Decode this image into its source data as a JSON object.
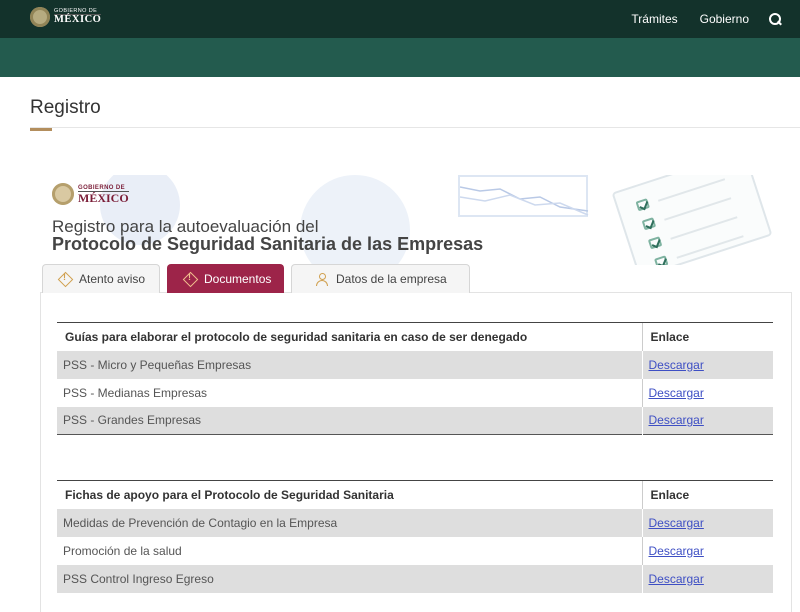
{
  "nav": {
    "logo_top": "GOBIERNO DE",
    "logo_bottom": "MÉXICO",
    "links": [
      "Trámites",
      "Gobierno"
    ]
  },
  "page": {
    "title": "Registro"
  },
  "banner": {
    "logo_top": "GOBIERNO DE",
    "logo_bottom": "MÉXICO",
    "title_line1": "Registro para la autoevaluación del",
    "title_line2": "Protocolo de Seguridad Sanitaria de las Empresas"
  },
  "tabs": [
    {
      "label": "Atento aviso",
      "icon": "warning-icon",
      "active": false
    },
    {
      "label": "Documentos",
      "icon": "warning-icon",
      "active": true
    },
    {
      "label": "Datos de la empresa",
      "icon": "people-icon",
      "active": false
    }
  ],
  "tables": [
    {
      "header": "Guías para elaborar el protocolo de seguridad sanitaria en caso de ser denegado",
      "link_header": "Enlace",
      "rows": [
        {
          "name": "PSS - Micro y Pequeñas Empresas",
          "link": "Descargar"
        },
        {
          "name": "PSS - Medianas Empresas",
          "link": "Descargar"
        },
        {
          "name": "PSS - Grandes Empresas",
          "link": "Descargar"
        }
      ]
    },
    {
      "header": "Fichas de apoyo para el Protocolo de Seguridad Sanitaria",
      "link_header": "Enlace",
      "rows": [
        {
          "name": "Medidas de Prevención de Contagio en la Empresa",
          "link": "Descargar"
        },
        {
          "name": "Promoción de la salud",
          "link": "Descargar"
        },
        {
          "name": "PSS Control Ingreso Egreso",
          "link": "Descargar"
        }
      ]
    }
  ],
  "colors": {
    "nav": "#13322b",
    "subnav": "#235b4e",
    "accent": "#9d2449",
    "gold": "#b38e5d",
    "link": "#3e4fc4"
  }
}
